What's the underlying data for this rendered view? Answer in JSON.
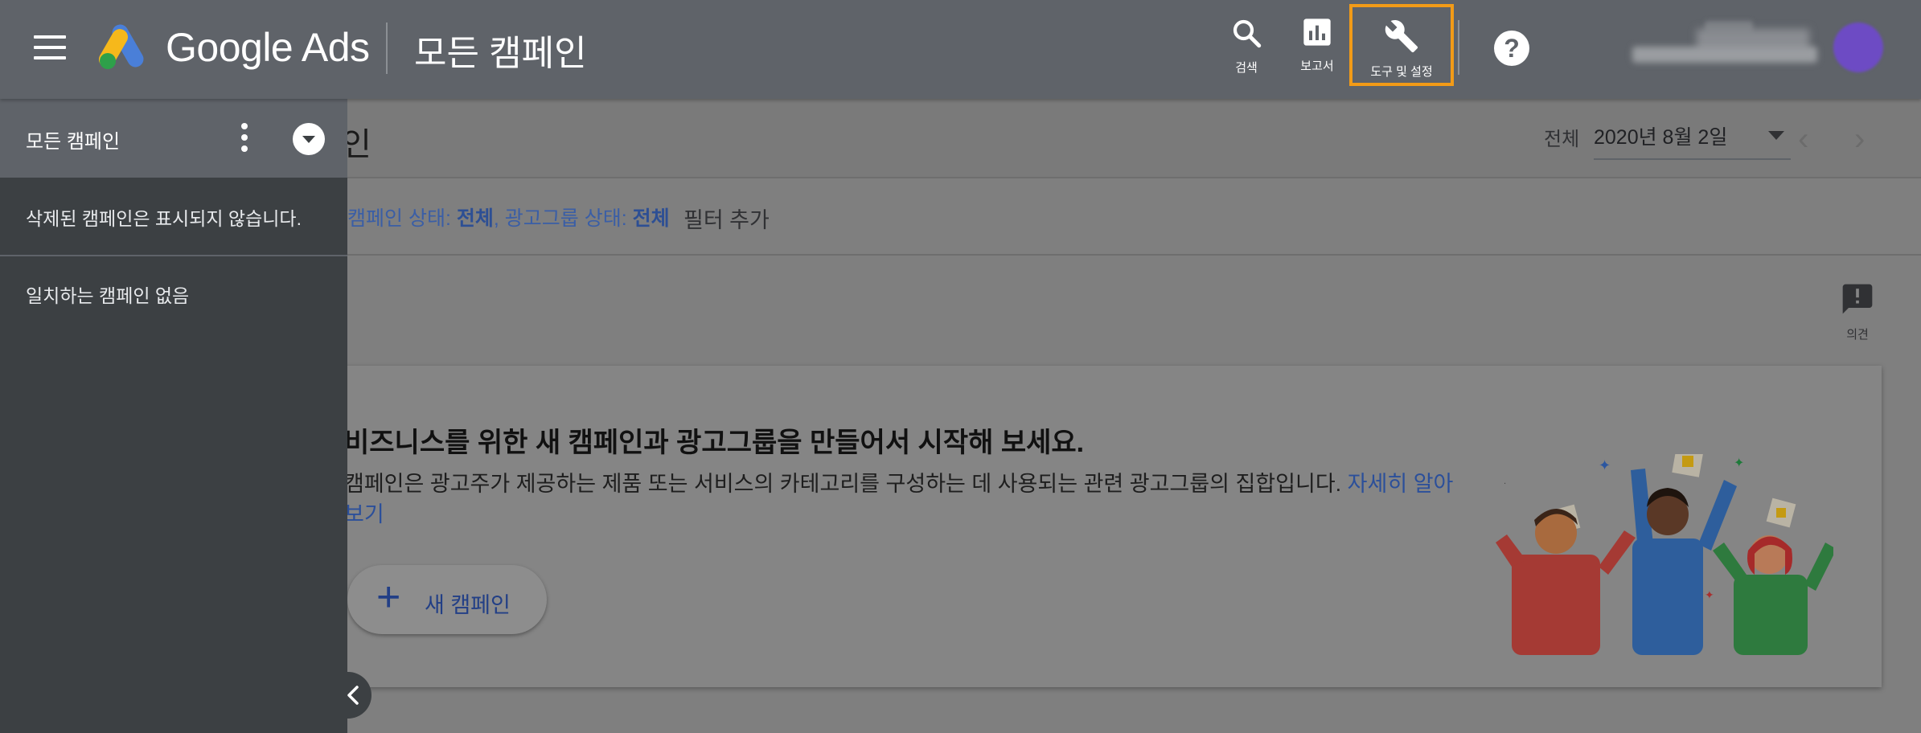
{
  "header": {
    "brand": "Google Ads",
    "page_title": "모든 캠페인",
    "nav": {
      "search_label": "검색",
      "reports_label": "보고서",
      "tools_label": "도구 및 설정"
    }
  },
  "toolbar": {
    "heading_stub": "인",
    "daterange_label": "전체",
    "date_value": "2020년 8월 2일"
  },
  "filters": {
    "campaign_status_label": "캠페인 상태: ",
    "campaign_status_value": "전체",
    "adgroup_status_label": ", 광고그룹 상태: ",
    "adgroup_status_value": "전체",
    "add_filter": "필터 추가"
  },
  "feedback": {
    "label": "의견"
  },
  "empty_state": {
    "title": "비즈니스를 위한 새 캠페인과 광고그룹을 만들어서 시작해 보세요.",
    "description": "캠페인은 광고주가 제공하는 제품 또는 서비스의 카테고리를 구성하는 데 사용되는 관련 광고그룹의 집합입니다. ",
    "learn_more": "자세히 알아보기",
    "new_campaign_button": "새 캠페인"
  },
  "drawer": {
    "title": "모든 캠페인",
    "note": "삭제된 캠페인은 표시되지 않습니다.",
    "empty_text": "일치하는 캠페인 없음"
  },
  "colors": {
    "header_bg": "#5f6369",
    "drawer_bg": "#3c4043",
    "highlight": "#f29b17",
    "link": "#2b4f9a"
  }
}
